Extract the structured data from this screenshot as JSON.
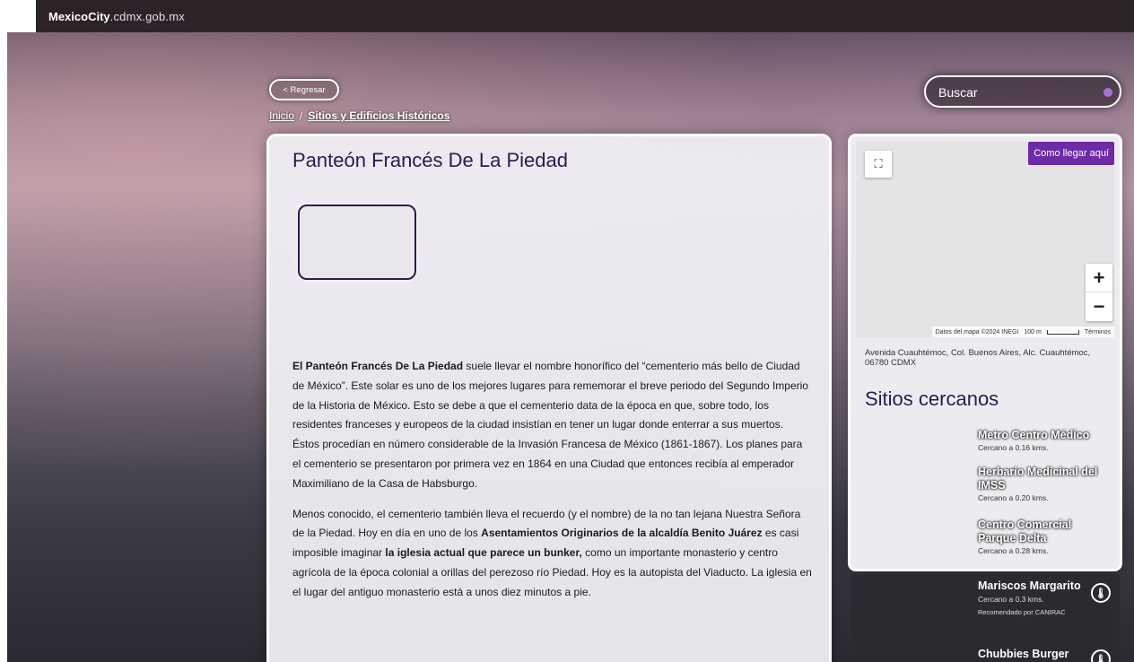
{
  "topbar": {
    "logo_bold": "MexicoCity",
    "logo_sub": ".cdmx.gob.mx"
  },
  "nav": {
    "back_label": "< Regresar",
    "breadcrumb": {
      "home": "Inicio",
      "sep": "/",
      "section": "Sitios y Edificios Históricos"
    }
  },
  "search": {
    "placeholder": "Buscar"
  },
  "article": {
    "title": "Panteón Francés De La Piedad",
    "p1_bold": "El Panteón Francés De La Piedad",
    "p1_rest": " suele llevar el nombre honorífico del “cementerio más bello de Ciudad de México”. Este solar es uno de los mejores lugares para rememorar el breve periodo del Segundo Imperio de la Historia de México. Esto se debe a que el cementerio data de la época en que, sobre todo, los residentes franceses y europeos de la ciudad insistían en tener un lugar donde enterrar a sus muertos. Éstos procedían en número considerable de la Invasión Francesa de México (1861-1867). Los planes para el cementerio se presentaron por primera vez en 1864 en una Ciudad que entonces recibía al emperador Maximiliano de la Casa de Habsburgo.",
    "p2_a": "Menos conocido, el cementerio también lleva el recuerdo (y el nombre) de la no tan lejana Nuestra Señora de la Piedad. Hoy en día en uno de los ",
    "p2_b1": "Asentamientos Originarios de la alcaldía Benito Juárez",
    "p2_c": "  es casi imposible imaginar ",
    "p2_b2": "la iglesia actual",
    "p2_d": "  ",
    "p2_b3": "que parece un bunker,",
    "p2_e": " como un importante monasterio y centro agrícola de la época colonial a orillas del perezoso río Piedad. Hoy es la autopista del Viaducto. La iglesia en el lugar del antiguo monasterio está a unos diez minutos a pie."
  },
  "map": {
    "route_label": "Como llegar aquí",
    "zoom_in": "+",
    "zoom_out": "−",
    "attribution": "Datos del mapa ©2024 INEGI",
    "scale": "100 m",
    "terms": "Términos"
  },
  "address": "Avenida Cuauhtémoc, Col. Buenos Aires, Alc. Cuauhtémoc, 06780 CDMX",
  "nearby": {
    "title": "Sitios cercanos",
    "items": [
      {
        "name": "Metro Centro Médico",
        "distance": "Cercano a 0.16 kms."
      },
      {
        "name": "Herbario Medicinal del IMSS",
        "distance": "Cercano a 0.20 kms."
      },
      {
        "name": "Centro Comercial Parque Delta",
        "distance": "Cercano a 0.28 kms."
      }
    ]
  },
  "restaurants": [
    {
      "name": "Mariscos Margarito",
      "distance": "Cercano a 0.3 kms.",
      "recommended": "Recomendado por CANIRAC"
    },
    {
      "name": "Chubbies Burger",
      "distance": "",
      "recommended": ""
    }
  ]
}
